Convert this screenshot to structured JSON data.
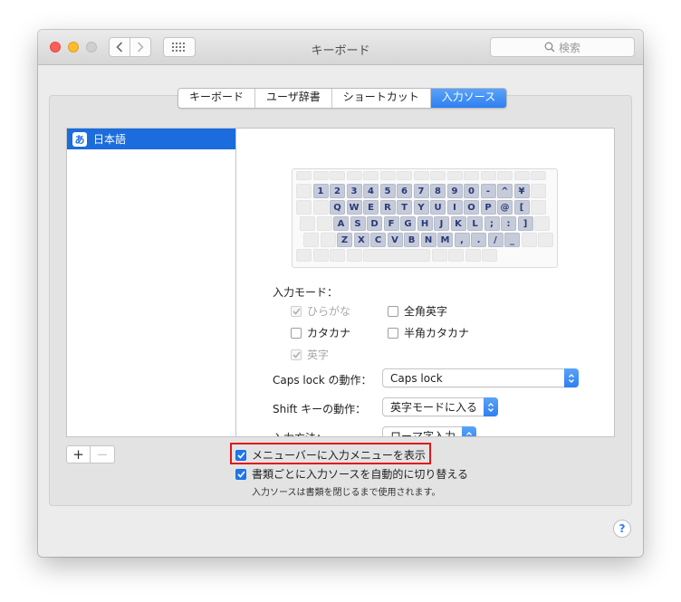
{
  "window": {
    "title": "キーボード"
  },
  "search": {
    "placeholder": "検索"
  },
  "tabs": [
    {
      "label": "キーボード",
      "active": false
    },
    {
      "label": "ユーザ辞書",
      "active": false
    },
    {
      "label": "ショートカット",
      "active": false
    },
    {
      "label": "入力ソース",
      "active": true
    }
  ],
  "sources": {
    "items": [
      {
        "icon_char": "あ",
        "label": "日本語",
        "selected": true
      }
    ]
  },
  "keyboard": {
    "rows": [
      [
        "1",
        "2",
        "3",
        "4",
        "5",
        "6",
        "7",
        "8",
        "9",
        "0",
        "-",
        "^",
        "¥"
      ],
      [
        "Q",
        "W",
        "E",
        "R",
        "T",
        "Y",
        "U",
        "I",
        "O",
        "P",
        "@",
        "["
      ],
      [
        "A",
        "S",
        "D",
        "F",
        "G",
        "H",
        "J",
        "K",
        "L",
        ";",
        ":",
        "]"
      ],
      [
        "Z",
        "X",
        "C",
        "V",
        "B",
        "N",
        "M",
        ",",
        ".",
        "/",
        "_"
      ]
    ]
  },
  "input_modes": {
    "label": "入力モード：",
    "options": [
      {
        "label": "ひらがな",
        "checked": true,
        "disabled": true
      },
      {
        "label": "全角英字",
        "checked": false,
        "disabled": false
      },
      {
        "label": "カタカナ",
        "checked": false,
        "disabled": false
      },
      {
        "label": "半角カタカナ",
        "checked": false,
        "disabled": false
      },
      {
        "label": "英字",
        "checked": true,
        "disabled": true
      }
    ]
  },
  "settings": {
    "capslock": {
      "label": "Caps lock の動作：",
      "value": "Caps lock"
    },
    "shift": {
      "label": "Shift キーの動作：",
      "value": "英字モードに入る"
    },
    "input_method": {
      "label": "入力方法：",
      "value": "ローマ字入力"
    }
  },
  "bottom": {
    "show_menu": {
      "label": "メニューバーに入力メニューを表示",
      "checked": true
    },
    "auto_switch": {
      "label": "書類ごとに入力ソースを自動的に切り替える",
      "checked": true
    },
    "note": "入力ソースは書類を閉じるまで使用されます。"
  },
  "help": {
    "label": "?"
  },
  "colors": {
    "accent": "#2f7ff1",
    "selection": "#1b6cdc",
    "highlight_box": "#e0171d"
  }
}
